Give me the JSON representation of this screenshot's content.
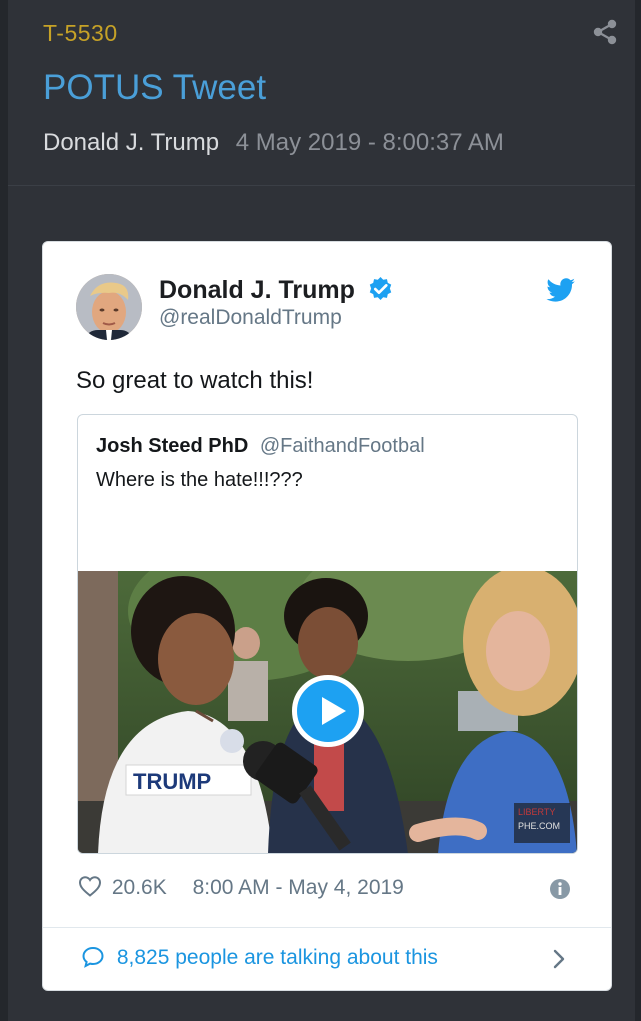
{
  "post": {
    "id": "T-5530",
    "title": "POTUS Tweet",
    "author": "Donald J. Trump",
    "date": "4 May 2019 - 8:00:37 AM"
  },
  "tweet": {
    "name": "Donald J. Trump",
    "handle": "@realDonaldTrump",
    "text": "So great to watch this!",
    "likes": "20.6K",
    "time": "8:00 AM - May 4, 2019",
    "talking": "8,825 people are talking about this",
    "quoted": {
      "name": "Josh Steed PhD",
      "handle": "@FaithandFootbal",
      "text": "Where is the hate!!!???"
    }
  },
  "video": {
    "shirt_text": "TRUMP",
    "watermark": "LIBERTY\nPHE.COM"
  },
  "colors": {
    "page_bg": "#2f3238",
    "id_gold": "#c6a227",
    "title_blue": "#4a9fd8",
    "twitter_blue": "#1da1f2"
  },
  "icons": {
    "share": "share-icon",
    "verified": "verified-badge-icon",
    "bird": "twitter-bird-icon",
    "heart": "heart-icon",
    "info": "info-icon",
    "bubble": "speech-bubble-icon",
    "chevron": "chevron-right-icon",
    "play": "play-icon"
  }
}
